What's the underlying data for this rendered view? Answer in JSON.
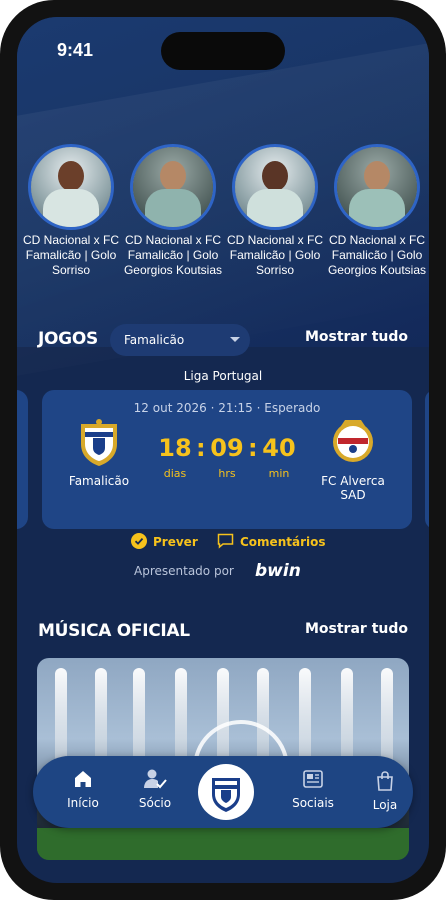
{
  "status_bar": {
    "time": "9:41"
  },
  "stories": [
    {
      "caption": "CD Nacional x FC Famalicão | Golo Sorriso"
    },
    {
      "caption": "CD Nacional x FC Famalicão | Golo Georgios Koutsias"
    },
    {
      "caption": "CD Nacional x FC Famalicão | Golo Sorriso"
    },
    {
      "caption": "CD Nacional x FC Famalicão | Golo Georgios Koutsias"
    }
  ],
  "games": {
    "title": "JOGOS",
    "filter_value": "Famalicão",
    "show_all": "Mostrar tudo",
    "league": "Liga Portugal",
    "match": {
      "datetime": "12 out 2026 · 21:15 · Esperado",
      "home_team": "Famalicão",
      "away_team": "FC Alverca SAD",
      "countdown": {
        "days": "18",
        "hours": "09",
        "minutes": "40",
        "days_label": "dias",
        "hours_label": "hrs",
        "minutes_label": "min"
      }
    },
    "predict_label": "Prever",
    "comments_label": "Comentários",
    "presented_by": "Apresentado por",
    "sponsor": "bwin"
  },
  "music": {
    "title": "MÚSICA OFICIAL",
    "show_all": "Mostrar tudo"
  },
  "tabbar": {
    "home": "Início",
    "member": "Sócio",
    "social": "Sociais",
    "store": "Loja"
  },
  "colors": {
    "accent": "#f6c21c",
    "background": "#142850",
    "card": "#1f4586"
  },
  "icons": {
    "home": "home-icon",
    "member": "member-check-icon",
    "social": "newspaper-icon",
    "store": "shopping-bag-icon"
  }
}
